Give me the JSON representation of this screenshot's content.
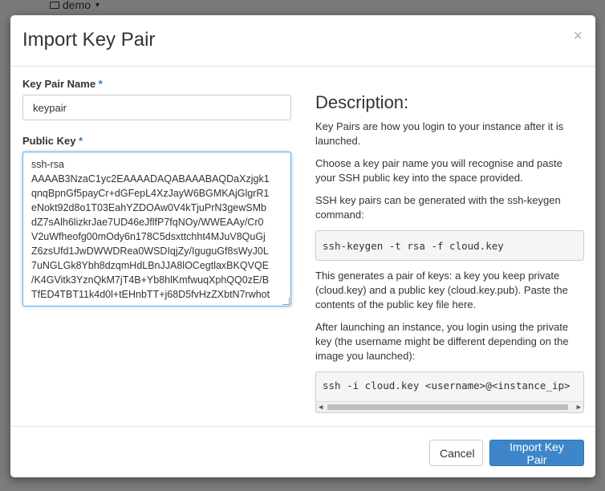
{
  "background": {
    "project_name": "demo"
  },
  "modal": {
    "title": "Import Key Pair",
    "close_symbol": "×"
  },
  "form": {
    "key_pair_name_label": "Key Pair Name",
    "key_pair_name_value": "keypair",
    "public_key_label": "Public Key",
    "required_mark": "*",
    "public_key_value": "ssh-rsa\nAAAAB3NzaC1yc2EAAAADAQABAAABAQDaXzjgk1\nqnqBpnGf5payCr+dGFepL4XzJayW6BGMKAjGlgrR1\neNokt92d8o1T03EahYZDOAw0V4kTjuPrN3gewSMb\ndZ7sAlh6lizkrJae7UD46eJflfP7fqNOy/WWEAAy/Cr0\nV2uWfheofg00mOdy6n178C5dsxttchht4MJuV8QuGj\nZ6zsUfd1JwDWWDRea0WSDIqjZy/IguguGf8sWyJ0L\n7uNGLGk8Ybh8dzqmHdLBnJJA8lOCegtlaxBKQVQE\n/K4GVitk3YznQkM7jT4B+Yb8hlKmfwuqXphQQ0zE/B\nTfED4TBT11k4d0l+tEHnbTT+j68D5fvHzZXbtN7rwhot"
  },
  "description": {
    "title": "Description:",
    "p1": "Key Pairs are how you login to your instance after it is launched.",
    "p2": "Choose a key pair name you will recognise and paste your SSH public key into the space provided.",
    "p3": "SSH key pairs can be generated with the ssh-keygen command:",
    "code1": "ssh-keygen -t rsa -f cloud.key",
    "p4": "This generates a pair of keys: a key you keep private (cloud.key) and a public key (cloud.key.pub). Paste the contents of the public key file here.",
    "p5": "After launching an instance, you login using the private key (the username might be different depending on the image you launched):",
    "code2": "ssh -i cloud.key <username>@<instance_ip>"
  },
  "footer": {
    "cancel_label": "Cancel",
    "submit_label": "Import Key Pair"
  },
  "colors": {
    "primary": "#3d86c9",
    "required": "#2f73c3",
    "focus": "#66afe9"
  }
}
